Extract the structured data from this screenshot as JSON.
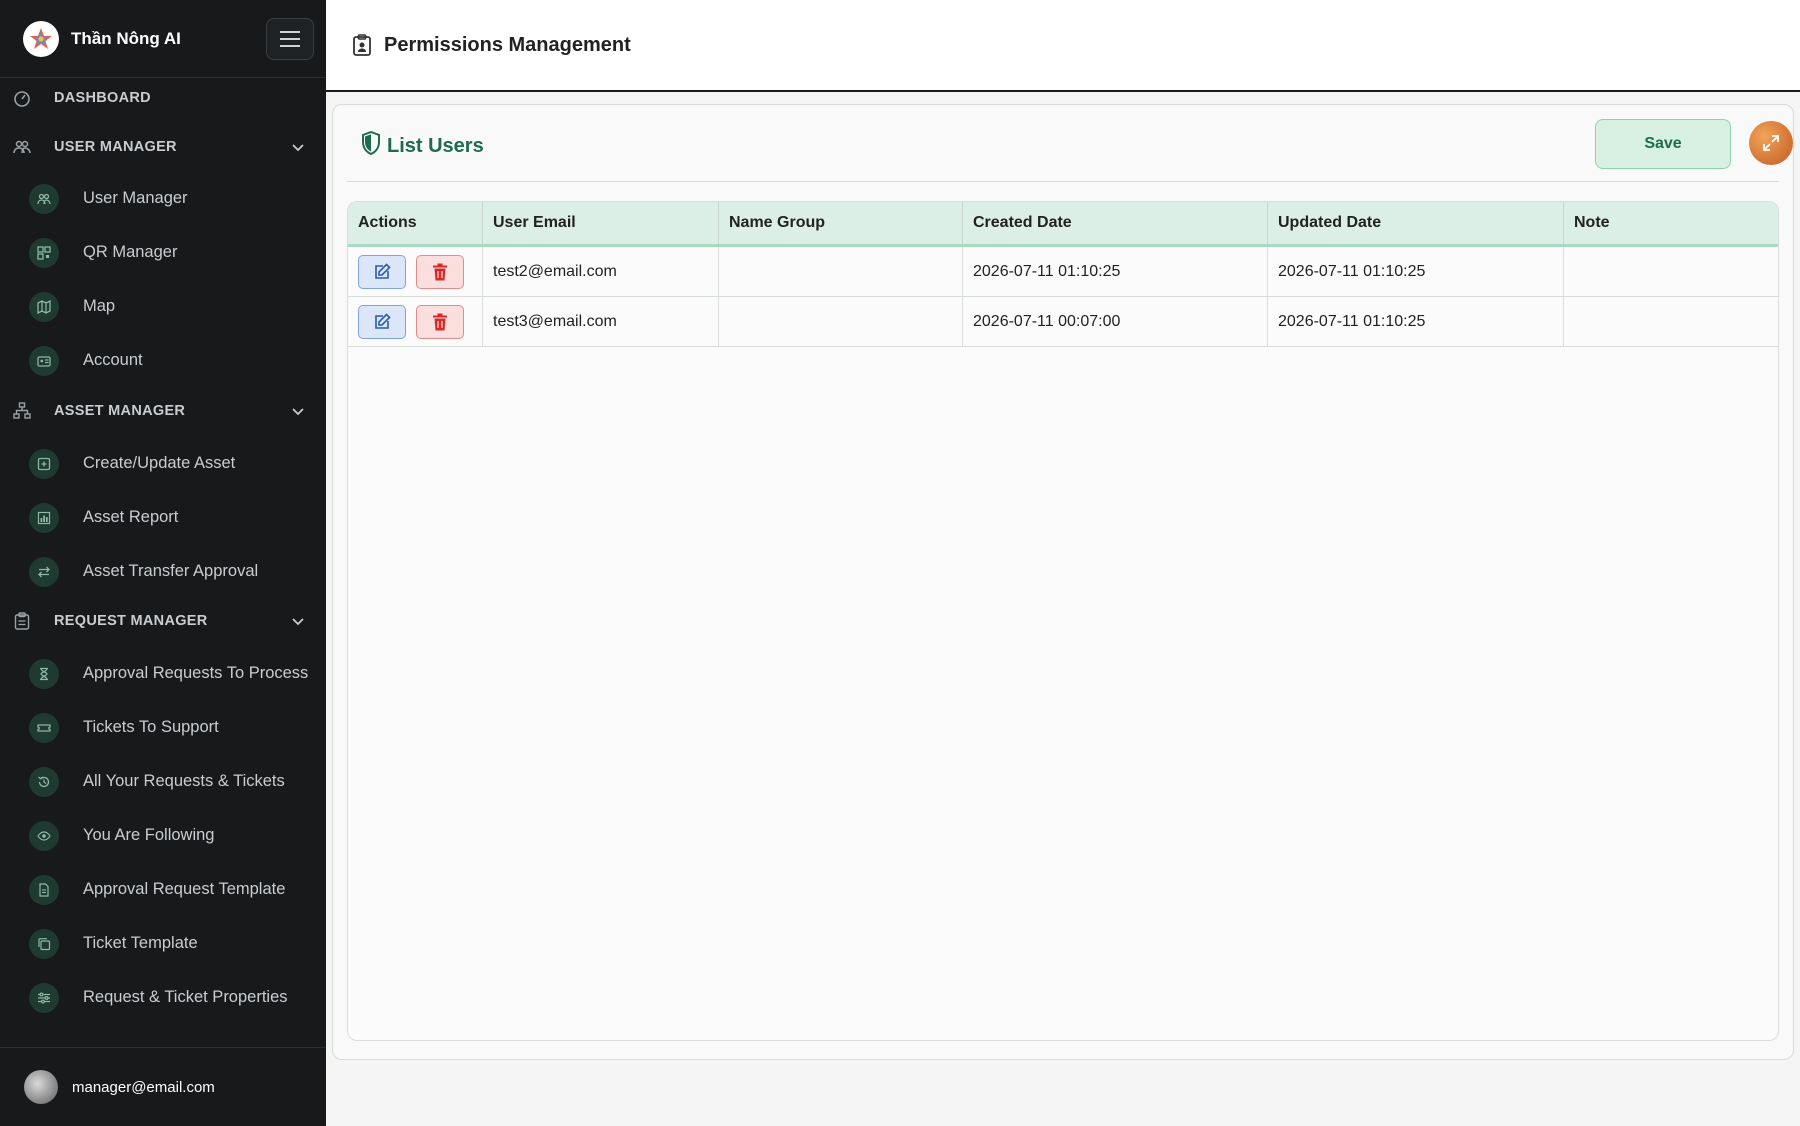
{
  "brand": {
    "name": "Thần Nông AI"
  },
  "sidebar": {
    "sections": [
      {
        "label": "DASHBOARD",
        "icon": "dashboard-icon"
      },
      {
        "label": "USER MANAGER",
        "icon": "users-icon"
      },
      {
        "label": "ASSET MANAGER",
        "icon": "sitemap-icon"
      },
      {
        "label": "REQUEST MANAGER",
        "icon": "clipboard-icon"
      }
    ],
    "user_items": [
      {
        "label": "User Manager",
        "icon": "users-icon"
      },
      {
        "label": "QR Manager",
        "icon": "qrcode-icon"
      },
      {
        "label": "Map",
        "icon": "map-icon"
      },
      {
        "label": "Account",
        "icon": "id-card-icon"
      }
    ],
    "asset_items": [
      {
        "label": "Create/Update Asset",
        "icon": "plus-square-icon"
      },
      {
        "label": "Asset Report",
        "icon": "bar-chart-icon"
      },
      {
        "label": "Asset Transfer Approval",
        "icon": "transfer-icon"
      }
    ],
    "request_items": [
      {
        "label": "Approval Requests To Process",
        "icon": "hourglass-icon"
      },
      {
        "label": "Tickets To Support",
        "icon": "ticket-icon"
      },
      {
        "label": "All Your Requests & Tickets",
        "icon": "history-icon"
      },
      {
        "label": "You Are Following",
        "icon": "eye-icon"
      },
      {
        "label": "Approval Request Template",
        "icon": "document-icon"
      },
      {
        "label": "Ticket Template",
        "icon": "copy-icon"
      },
      {
        "label": "Request & Ticket Properties",
        "icon": "sliders-icon"
      }
    ],
    "footer": {
      "user_email": "manager@email.com"
    }
  },
  "header": {
    "title": "Permissions Management"
  },
  "card": {
    "title": "List Users",
    "save_label": "Save"
  },
  "table": {
    "columns": [
      "Actions",
      "User Email",
      "Name Group",
      "Created Date",
      "Updated Date",
      "Note"
    ],
    "rows": [
      {
        "email": "test2@email.com",
        "group": "",
        "created": "2026-07-11 01:10:25",
        "updated": "2026-07-11 01:10:25",
        "note": ""
      },
      {
        "email": "test3@email.com",
        "group": "",
        "created": "2026-07-11 00:07:00",
        "updated": "2026-07-11 01:10:25",
        "note": ""
      }
    ]
  },
  "colors": {
    "sidebar_bg": "#17191b",
    "accent_green": "#1e6b4e",
    "save_bg": "#d7f0e2",
    "edit_blue": "#2a5bb3",
    "delete_red": "#d62b2b"
  }
}
